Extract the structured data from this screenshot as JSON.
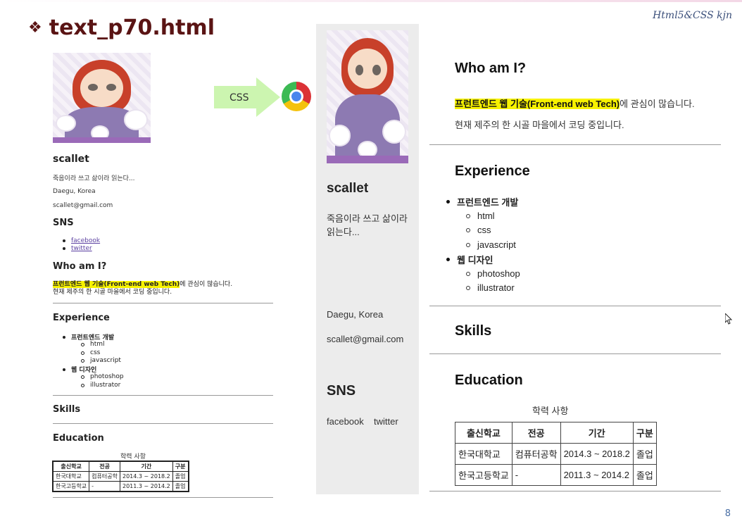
{
  "slide": {
    "title": "text_p70.html",
    "brand": "Html5&CSS kjn",
    "page_number": "8"
  },
  "arrow": {
    "label": "CSS"
  },
  "doc": {
    "name": "scallet",
    "quote": "죽음이라 쓰고 삶이라 읽는다...",
    "location": "Daegu, Korea",
    "email": "scallet@gmail.com",
    "sns_heading": "SNS",
    "sns_links": [
      "facebook",
      "twitter"
    ],
    "who_heading": "Who am I?",
    "who_highlight": "프런트엔드 웹 기술(Front-end web Tech)",
    "who_rest": "에 관심이 많습니다.",
    "who_line2": "현재 제주의 한 시골 마을에서 코딩 중입니다.",
    "experience_heading": "Experience",
    "exp": [
      {
        "label": "프런트엔드 개발",
        "items": [
          "html",
          "css",
          "javascript"
        ]
      },
      {
        "label": "웹 디자인",
        "items": [
          "photoshop",
          "illustrator"
        ]
      }
    ],
    "skills_heading": "Skills",
    "education_heading": "Education",
    "table_caption": "학력 사항",
    "table_headers": [
      "출신학교",
      "전공",
      "기간",
      "구분"
    ],
    "table_rows": [
      [
        "한국대학교",
        "컴퓨터공학",
        "2014.3 ~ 2018.2",
        "졸업"
      ],
      [
        "한국고등학교",
        "-",
        "2011.3 ~ 2014.2",
        "졸업"
      ]
    ]
  },
  "page": {
    "name": "scallet",
    "quote_line1": "죽음이라 쓰고 삶이라",
    "quote_line2": "읽는다...",
    "location": "Daegu, Korea",
    "email": "scallet@gmail.com",
    "sns_heading": "SNS",
    "sns_links": [
      "facebook",
      "twitter"
    ],
    "who_heading": "Who am I?",
    "who_highlight": "프런트엔드 웹 기술(Front-end web Tech)",
    "who_rest": "에 관심이 많습니다.",
    "who_line2": "현재 제주의 한 시골 마을에서 코딩 중입니다.",
    "experience_heading": "Experience",
    "exp": [
      {
        "label": "프런트엔드 개발",
        "items": [
          "html",
          "css",
          "javascript"
        ]
      },
      {
        "label": "웹 디자인",
        "items": [
          "photoshop",
          "illustrator"
        ]
      }
    ],
    "skills_heading": "Skills",
    "education_heading": "Education",
    "table_caption": "학력 사항",
    "table_headers": [
      "출신학교",
      "전공",
      "기간",
      "구분"
    ],
    "table_rows": [
      [
        "한국대학교",
        "컴퓨터공학",
        "2014.3 ~ 2018.2",
        "졸업"
      ],
      [
        "한국고등학교",
        "-",
        "2011.3 ~ 2014.2",
        "졸업"
      ]
    ]
  },
  "colors": {
    "title": "#5a1414",
    "highlight": "#f7f200",
    "sidebar_bg": "#ececec",
    "arrow_fill": "#ccf5b0"
  },
  "icons": {
    "arrow": "right-arrow-icon",
    "browser": "chrome-icon",
    "bullet": "diamond-bullet-icon",
    "cursor": "mouse-pointer-icon"
  }
}
